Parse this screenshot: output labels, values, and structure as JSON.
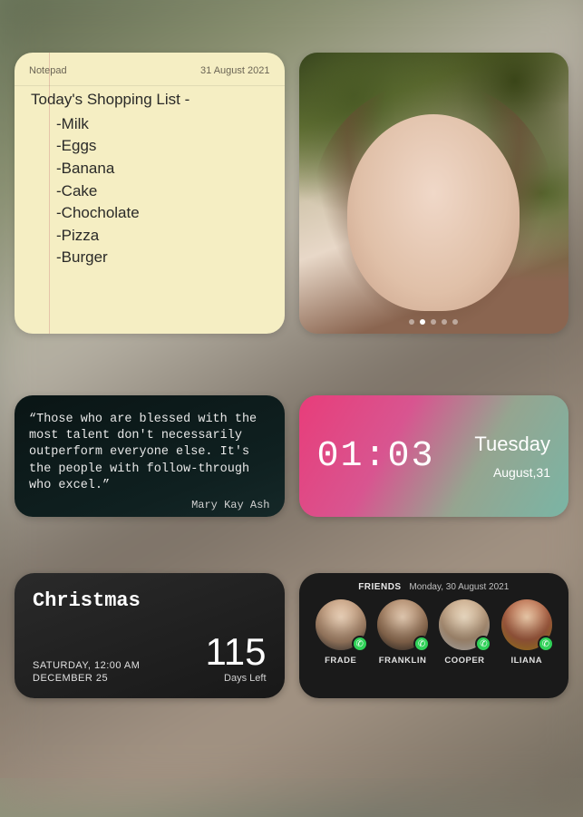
{
  "notepad": {
    "label": "Notepad",
    "date": "31 August 2021",
    "title": "Today's Shopping List -",
    "items": [
      "Milk",
      "Eggs",
      "Banana",
      "Cake",
      "Chocholate",
      "Pizza",
      "Burger"
    ]
  },
  "photo": {
    "page_count": 5,
    "active_page": 2
  },
  "quote": {
    "text": "Those who are blessed with the most talent don't necessarily outperform everyone else. It's the people with follow-through who excel.",
    "author": "Mary Kay Ash"
  },
  "clock": {
    "time": "01:03",
    "day": "Tuesday",
    "date": "August,31"
  },
  "countdown": {
    "title": "Christmas",
    "day_line": "SATURDAY, 12:00 AM",
    "date_line": "DECEMBER 25",
    "number": "115",
    "label": "Days Left"
  },
  "friends": {
    "label": "FRIENDS",
    "date": "Monday, 30 August 2021",
    "list": [
      {
        "name": "FRADE"
      },
      {
        "name": "FRANKLIN"
      },
      {
        "name": "COOPER"
      },
      {
        "name": "ILIANA"
      }
    ]
  }
}
